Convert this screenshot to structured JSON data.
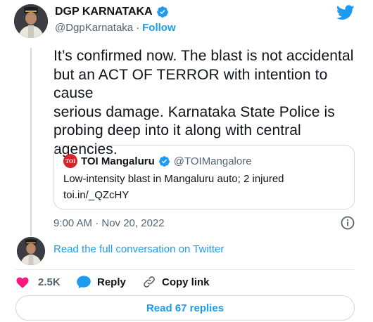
{
  "author": {
    "name": "DGP KARNATAKA",
    "handle": "@DgpKarnataka",
    "separator": "·",
    "follow_label": "Follow"
  },
  "tweet": {
    "lines": [
      "It’s confirmed now. The blast is not accidental",
      "but an ACT OF TERROR with intention to cause",
      "serious damage. Karnataka State Police is",
      "probing deep into it along with central",
      "agencies."
    ],
    "timestamp": "9:00 AM · Nov 20, 2022"
  },
  "quote": {
    "logo_text": "TOI",
    "name": "TOI Mangaluru",
    "handle": "@TOIMangalore",
    "text": "Low-intensity blast in Mangaluru auto; 2 injured",
    "link": "toi.in/_QZcHY"
  },
  "conversation": {
    "label": "Read the full conversation on Twitter"
  },
  "actions": {
    "likes": "2.5K",
    "reply_label": "Reply",
    "copy_link_label": "Copy link"
  },
  "replies_button": {
    "label": "Read 67 replies"
  },
  "colors": {
    "accent": "#1d9bf0",
    "like": "#f91880",
    "text": "#0f1419",
    "muted": "#536471",
    "toi_red": "#d6252a"
  },
  "icons": [
    "twitter-bird-icon",
    "verified-badge-icon",
    "info-icon",
    "heart-icon",
    "reply-bubble-icon",
    "link-icon"
  ]
}
